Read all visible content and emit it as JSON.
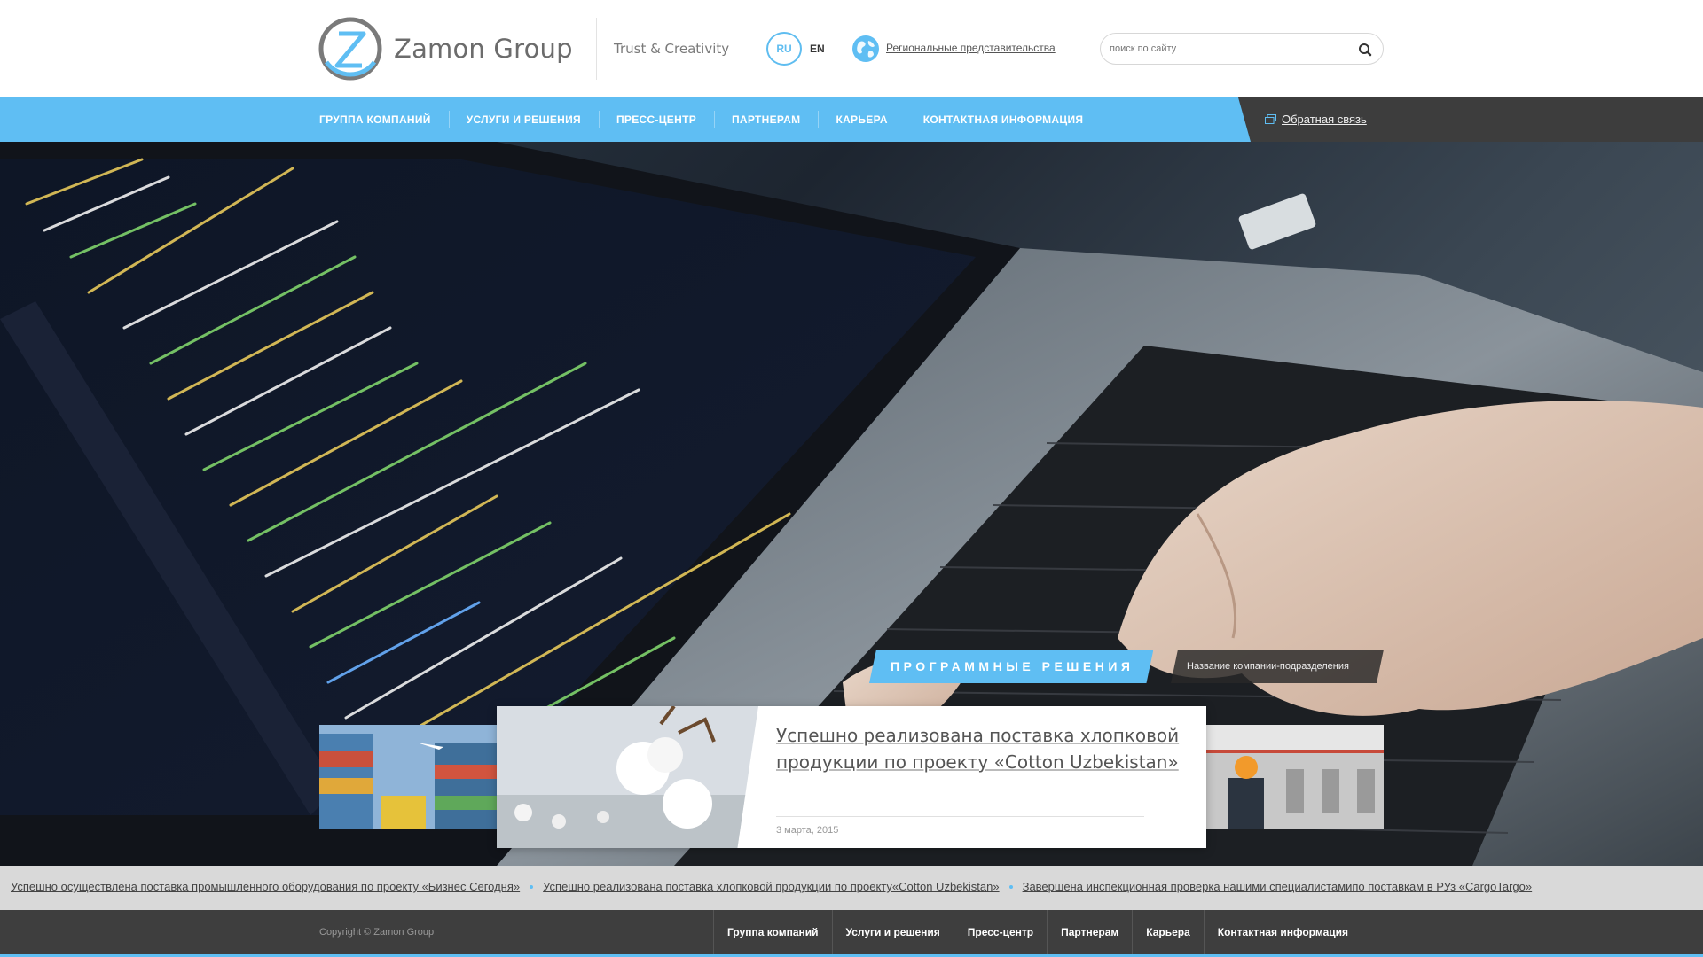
{
  "header": {
    "logo_text": "Zamon Group",
    "tagline": "Trust & Creativity",
    "lang_ru": "RU",
    "lang_en": "EN",
    "regional_link": "Региональные представительства",
    "search_placeholder": "поиск по сайту"
  },
  "nav": {
    "items": [
      "ГРУППА КОМПАНИЙ",
      "УСЛУГИ И РЕШЕНИЯ",
      "ПРЕСС-ЦЕНТР",
      "ПАРТНЕРАМ",
      "КАРЬЕРА",
      "КОНТАКТНАЯ ИНФОРМАЦИЯ"
    ],
    "feedback": "Обратная связь"
  },
  "hero": {
    "category": "ПРОГРАММНЫЕ РЕШЕНИЯ",
    "company": "Название компании-подразделения"
  },
  "news": {
    "title": "Успешно реализована поставка хлопковой продукции по проекту «Cotton Uzbekistan»",
    "date": "3 марта, 2015"
  },
  "ticker": {
    "items": [
      "Успешно осуществлена поставка промышленного оборудования по проекту «Бизнес Сегодня»",
      "Успешно реализована поставка хлопковой продукции по проекту«Cotton Uzbekistan»",
      "Завершена инспекционная проверка нашими специалистамипо поставкам в РУз «CargoTargo»"
    ]
  },
  "footer": {
    "copyright": "Copyright © Zamon Group",
    "items": [
      "Группа компаний",
      "Услуги и решения",
      "Пресс-центр",
      "Партнерам",
      "Карьера",
      "Контактная информация"
    ]
  },
  "colors": {
    "accent": "#5fbef3",
    "dark": "#3e3e3e",
    "ticker_bg": "#d9d9d9"
  }
}
